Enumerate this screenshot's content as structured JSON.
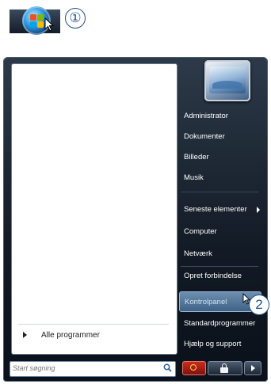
{
  "callouts": {
    "one": "①",
    "two": "2"
  },
  "left_pane": {
    "all_programs": "Alle programmer",
    "search_placeholder": "Start søgning"
  },
  "right_items": [
    {
      "label": "Administrator"
    },
    {
      "label": "Dokumenter"
    },
    {
      "label": "Billeder"
    },
    {
      "label": "Musik"
    },
    {
      "label": "Seneste elementer"
    },
    {
      "label": "Computer"
    },
    {
      "label": "Netværk"
    },
    {
      "label": "Opret forbindelse"
    },
    {
      "label": "Kontrolpanel"
    },
    {
      "label": "Standardprogrammer"
    },
    {
      "label": "Hjælp og support"
    }
  ],
  "colors": {
    "menu_bg": "#121a25",
    "highlight": "#4f739a",
    "callout": "#1c4f8c"
  },
  "icons": [
    "windows-orb-icon",
    "mouse-cursor-icon",
    "search-icon",
    "power-icon",
    "lock-icon",
    "arrow-right-icon"
  ]
}
